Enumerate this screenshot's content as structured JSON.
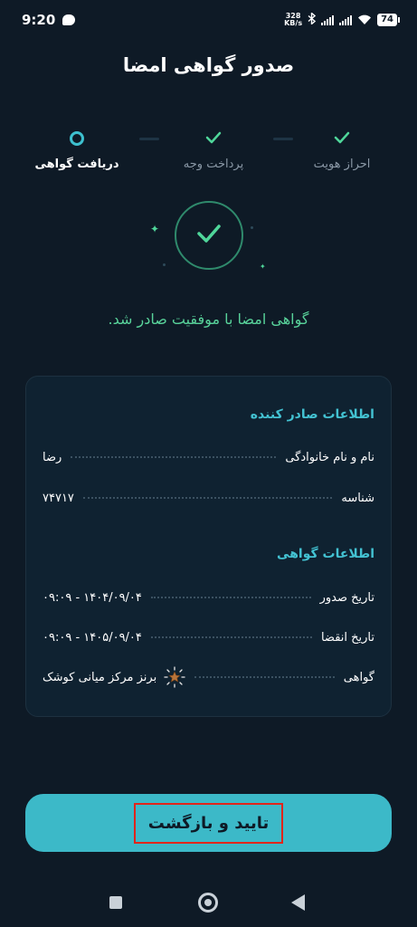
{
  "status_bar": {
    "time": "9:20",
    "net_speed_top": "328",
    "net_speed_bottom": "KB/s",
    "battery": "74"
  },
  "page": {
    "title": "صدور گواهی امضا"
  },
  "stepper": {
    "steps": [
      {
        "label": "احراز هویت",
        "state": "done"
      },
      {
        "label": "پرداخت وجه",
        "state": "done"
      },
      {
        "label": "دریافت گواهی",
        "state": "active"
      }
    ],
    "accent": "#3dc0cf",
    "done_color": "#4fd69a"
  },
  "success": {
    "message": "گواهی امضا با موفقیت صادر شد."
  },
  "issuer_section": {
    "title": "اطلاعات صادر کننده",
    "rows": [
      {
        "key": "نام و نام خانوادگی",
        "value": "رضا"
      },
      {
        "key": "شناسه",
        "value": "۷۴۷۱۷"
      }
    ]
  },
  "cert_section": {
    "title": "اطلاعات گواهی",
    "rows": [
      {
        "key": "تاریخ صدور",
        "value": "۱۴۰۴/۰۹/۰۴   -   ۰۹:۰۹"
      },
      {
        "key": "تاریخ انقضا",
        "value": "۱۴۰۵/۰۹/۰۴   -   ۰۹:۰۹"
      },
      {
        "key": "گواهی",
        "value": "برنز مرکز میانی کوشک",
        "icon": "bronze-star-badge-icon"
      }
    ]
  },
  "actions": {
    "confirm_label": "تایید و بازگشت",
    "button_color": "#3cb9c8"
  }
}
